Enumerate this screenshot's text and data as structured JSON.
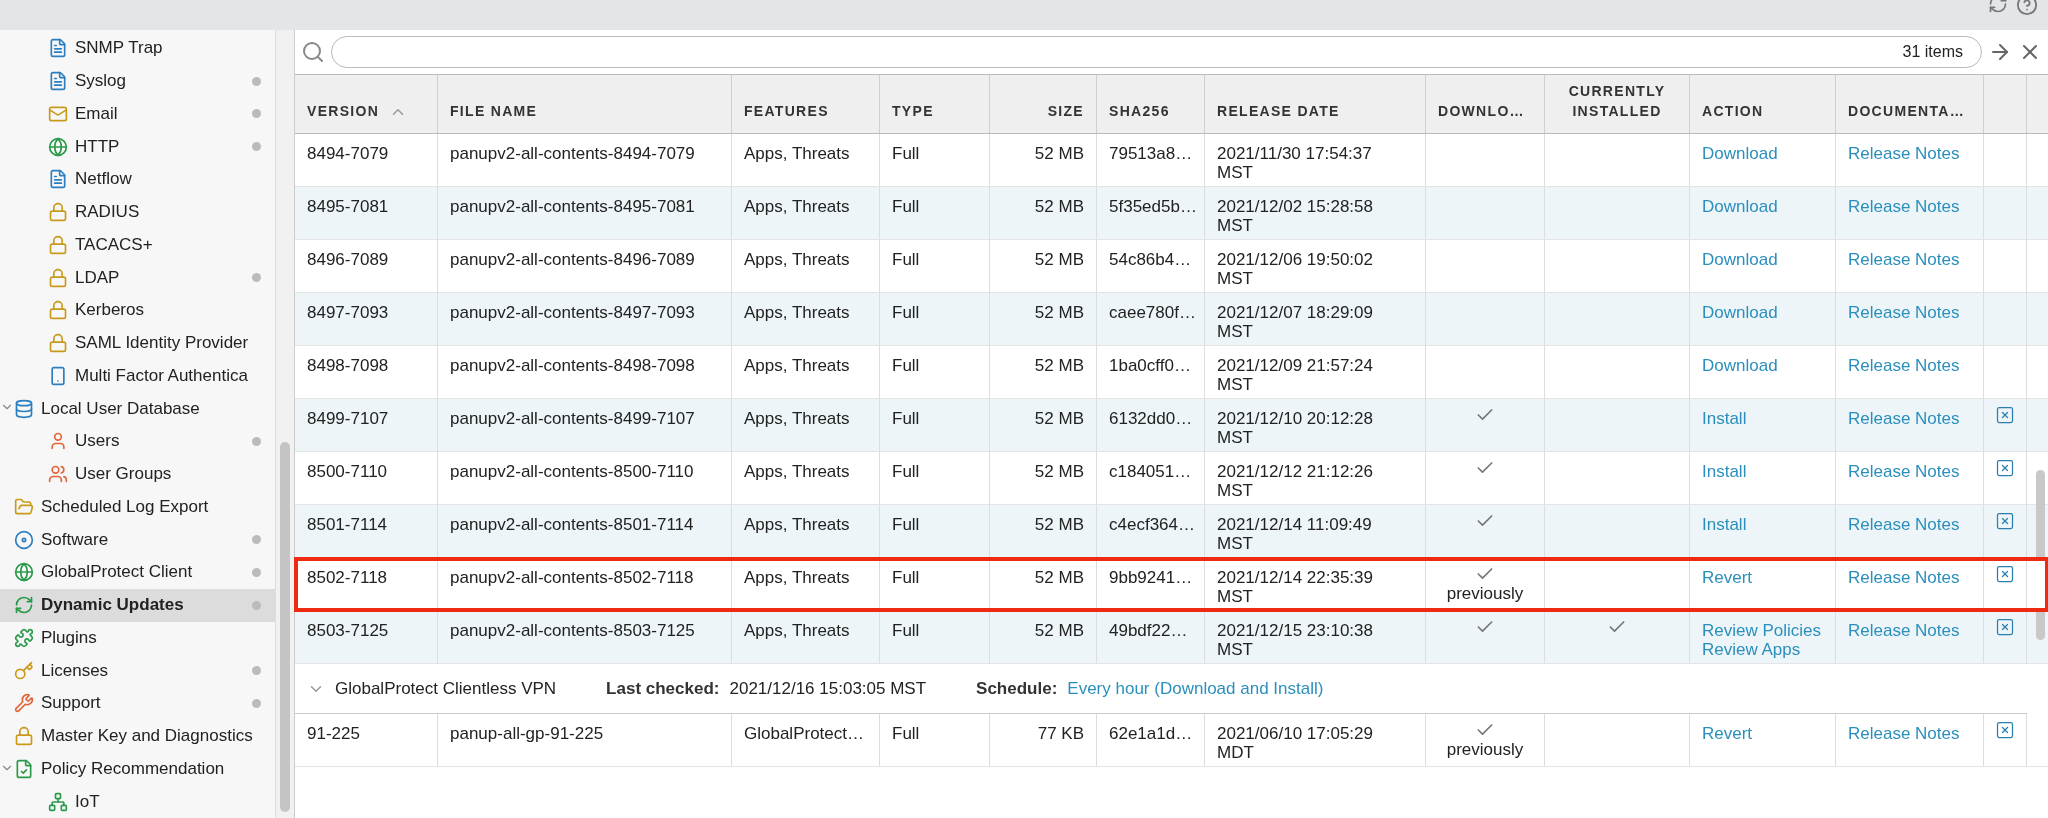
{
  "sidebar": {
    "continued_children": [
      {
        "label": "SNMP Trap",
        "kind": "logserver",
        "dot": false,
        "selected": false
      },
      {
        "label": "Syslog",
        "kind": "logserver",
        "dot": true,
        "selected": false
      },
      {
        "label": "Email",
        "kind": "email",
        "dot": true,
        "selected": false
      },
      {
        "label": "HTTP",
        "kind": "http",
        "dot": true,
        "selected": false
      },
      {
        "label": "Netflow",
        "kind": "logserver",
        "dot": false,
        "selected": false
      },
      {
        "label": "RADIUS",
        "kind": "authserver",
        "dot": false,
        "selected": false
      },
      {
        "label": "TACACS+",
        "kind": "authserver",
        "dot": false,
        "selected": false
      },
      {
        "label": "LDAP",
        "kind": "authserver",
        "dot": true,
        "selected": false
      },
      {
        "label": "Kerberos",
        "kind": "authserver",
        "dot": false,
        "selected": false
      },
      {
        "label": "SAML Identity Provider",
        "kind": "authserver",
        "dot": false,
        "selected": false
      },
      {
        "label": "Multi Factor Authentica",
        "kind": "mfa",
        "dot": false,
        "selected": false
      }
    ],
    "items": [
      {
        "label": "Local User Database",
        "kind": "database",
        "dot": false,
        "selected": false,
        "expanded": true,
        "children": [
          {
            "label": "Users",
            "kind": "user",
            "dot": true,
            "selected": false
          },
          {
            "label": "User Groups",
            "kind": "group",
            "dot": false,
            "selected": false
          }
        ]
      },
      {
        "label": "Scheduled Log Export",
        "kind": "export",
        "dot": false,
        "selected": false
      },
      {
        "label": "Software",
        "kind": "software",
        "dot": true,
        "selected": false
      },
      {
        "label": "GlobalProtect Client",
        "kind": "globe",
        "dot": true,
        "selected": false
      },
      {
        "label": "Dynamic Updates",
        "kind": "dynamic",
        "dot": true,
        "selected": true
      },
      {
        "label": "Plugins",
        "kind": "plugin",
        "dot": false,
        "selected": false
      },
      {
        "label": "Licenses",
        "kind": "license",
        "dot": true,
        "selected": false
      },
      {
        "label": "Support",
        "kind": "support",
        "dot": true,
        "selected": false
      },
      {
        "label": "Master Key and Diagnostics",
        "kind": "masterkey",
        "dot": false,
        "selected": false
      },
      {
        "label": "Policy Recommendation",
        "kind": "policy",
        "dot": false,
        "selected": false,
        "expanded": true,
        "children": [
          {
            "label": "IoT",
            "kind": "iot",
            "dot": false,
            "selected": false
          }
        ]
      }
    ]
  },
  "search": {
    "count": "31 items"
  },
  "table": {
    "columns": [
      {
        "label": "VERSION",
        "sorted": true
      },
      {
        "label": "FILE NAME"
      },
      {
        "label": "FEATURES"
      },
      {
        "label": "TYPE"
      },
      {
        "label": "SIZE"
      },
      {
        "label": "SHA256"
      },
      {
        "label": "RELEASE DATE"
      },
      {
        "label": "DOWNLO…"
      },
      {
        "label": "CURRENTLY INSTALLED"
      },
      {
        "label": "ACTION"
      },
      {
        "label": "DOCUMENTA…"
      }
    ],
    "rows": [
      {
        "version": "8494-7079",
        "file_name": "panupv2-all-contents-8494-7079",
        "features": "Apps, Threats",
        "type": "Full",
        "size": "52 MB",
        "sha256": "79513a8…",
        "release_date": "2021/11/30 17:54:37 MST",
        "downloaded": false,
        "currently_installed": false,
        "actions": [
          "Download"
        ],
        "documentation": "Release Notes",
        "deletable": false,
        "highlighted": false
      },
      {
        "version": "8495-7081",
        "file_name": "panupv2-all-contents-8495-7081",
        "features": "Apps, Threats",
        "type": "Full",
        "size": "52 MB",
        "sha256": "5f35ed5b…",
        "release_date": "2021/12/02 15:28:58 MST",
        "downloaded": false,
        "currently_installed": false,
        "actions": [
          "Download"
        ],
        "documentation": "Release Notes",
        "deletable": false,
        "highlighted": false
      },
      {
        "version": "8496-7089",
        "file_name": "panupv2-all-contents-8496-7089",
        "features": "Apps, Threats",
        "type": "Full",
        "size": "52 MB",
        "sha256": "54c86b4…",
        "release_date": "2021/12/06 19:50:02 MST",
        "downloaded": false,
        "currently_installed": false,
        "actions": [
          "Download"
        ],
        "documentation": "Release Notes",
        "deletable": false,
        "highlighted": false
      },
      {
        "version": "8497-7093",
        "file_name": "panupv2-all-contents-8497-7093",
        "features": "Apps, Threats",
        "type": "Full",
        "size": "52 MB",
        "sha256": "caee780f…",
        "release_date": "2021/12/07 18:29:09 MST",
        "downloaded": false,
        "currently_installed": false,
        "actions": [
          "Download"
        ],
        "documentation": "Release Notes",
        "deletable": false,
        "highlighted": false
      },
      {
        "version": "8498-7098",
        "file_name": "panupv2-all-contents-8498-7098",
        "features": "Apps, Threats",
        "type": "Full",
        "size": "52 MB",
        "sha256": "1ba0cff0…",
        "release_date": "2021/12/09 21:57:24 MST",
        "downloaded": false,
        "currently_installed": false,
        "actions": [
          "Download"
        ],
        "documentation": "Release Notes",
        "deletable": false,
        "highlighted": false
      },
      {
        "version": "8499-7107",
        "file_name": "panupv2-all-contents-8499-7107",
        "features": "Apps, Threats",
        "type": "Full",
        "size": "52 MB",
        "sha256": "6132dd0…",
        "release_date": "2021/12/10 20:12:28 MST",
        "downloaded": true,
        "currently_installed": false,
        "actions": [
          "Install"
        ],
        "documentation": "Release Notes",
        "deletable": true,
        "highlighted": false
      },
      {
        "version": "8500-7110",
        "file_name": "panupv2-all-contents-8500-7110",
        "features": "Apps, Threats",
        "type": "Full",
        "size": "52 MB",
        "sha256": "c184051…",
        "release_date": "2021/12/12 21:12:26 MST",
        "downloaded": true,
        "currently_installed": false,
        "actions": [
          "Install"
        ],
        "documentation": "Release Notes",
        "deletable": true,
        "highlighted": false
      },
      {
        "version": "8501-7114",
        "file_name": "panupv2-all-contents-8501-7114",
        "features": "Apps, Threats",
        "type": "Full",
        "size": "52 MB",
        "sha256": "c4ecf364…",
        "release_date": "2021/12/14 11:09:49 MST",
        "downloaded": true,
        "currently_installed": false,
        "actions": [
          "Install"
        ],
        "documentation": "Release Notes",
        "deletable": true,
        "highlighted": false
      },
      {
        "version": "8502-7118",
        "file_name": "panupv2-all-contents-8502-7118",
        "features": "Apps, Threats",
        "type": "Full",
        "size": "52 MB",
        "sha256": "9bb9241…",
        "release_date": "2021/12/14 22:35:39 MST",
        "downloaded": true,
        "download_note": "previously",
        "currently_installed": false,
        "actions": [
          "Revert"
        ],
        "documentation": "Release Notes",
        "deletable": true,
        "highlighted": true
      },
      {
        "version": "8503-7125",
        "file_name": "panupv2-all-contents-8503-7125",
        "features": "Apps, Threats",
        "type": "Full",
        "size": "52 MB",
        "sha256": "49bdf22…",
        "release_date": "2021/12/15 23:10:38 MST",
        "downloaded": true,
        "currently_installed": true,
        "actions": [
          "Review Policies",
          "Review Apps"
        ],
        "documentation": "Release Notes",
        "deletable": true,
        "highlighted": false
      }
    ],
    "sections": [
      {
        "title": "GlobalProtect Clientless VPN",
        "expanded": true,
        "last_checked_label": "Last checked:",
        "last_checked": "2021/12/16 15:03:05 MST",
        "schedule_label": "Schedule:",
        "schedule": "Every hour (Download and Install)",
        "rows": [
          {
            "version": "91-225",
            "file_name": "panup-all-gp-91-225",
            "features": "GlobalProtect…",
            "type": "Full",
            "size": "77 KB",
            "sha256": "62e1a1d…",
            "release_date": "2021/06/10 17:05:29 MDT",
            "downloaded": true,
            "download_note": "previously",
            "currently_installed": false,
            "actions": [
              "Revert"
            ],
            "documentation": "Release Notes",
            "deletable": true,
            "highlighted": false
          }
        ]
      }
    ]
  }
}
